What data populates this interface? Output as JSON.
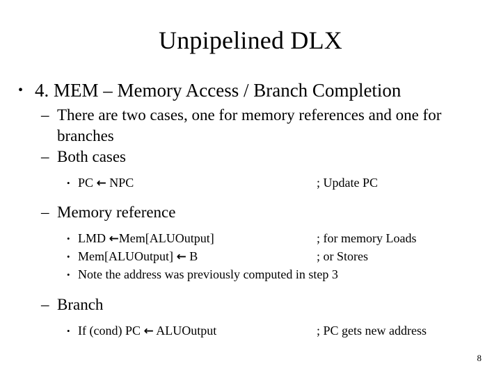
{
  "slide": {
    "title": "Unpipelined DLX",
    "page_number": "8",
    "background_color": "#ffffff",
    "text_color": "#000000",
    "bullet_marker_level1": "•",
    "bullet_marker_level2": "–",
    "bullet_marker_level3": "•",
    "arrow_glyph": "←",
    "content": {
      "main_bullet": "4. MEM – Memory Access / Branch Completion",
      "two_cases": "There are two cases, one for memory references and one for branches",
      "both_cases_heading": "Both cases",
      "both_cases_items": [
        {
          "code_before_arrow": "PC ",
          "code_after_arrow": " NPC",
          "comment": "; Update PC"
        }
      ],
      "memory_reference_heading": "Memory reference",
      "memory_reference_items": [
        {
          "code_before_arrow": "LMD ",
          "code_after_arrow": "Mem[ALUOutput]",
          "comment": "; for memory Loads"
        },
        {
          "code_before_arrow": "Mem[ALUOutput] ",
          "code_after_arrow": " B",
          "comment": "; or Stores"
        }
      ],
      "memory_reference_note": "Note the address was previously computed in step 3",
      "branch_heading": "Branch",
      "branch_items": [
        {
          "code_before_arrow": "If (cond) PC ",
          "code_after_arrow": " ALUOutput",
          "comment": "; PC gets new address"
        }
      ]
    }
  }
}
